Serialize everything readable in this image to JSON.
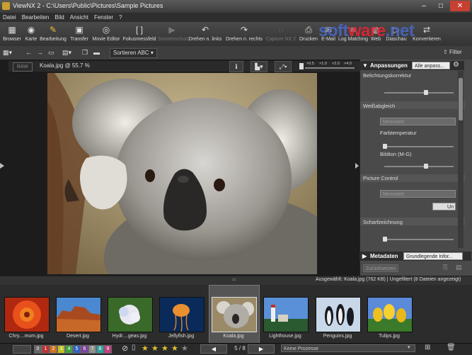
{
  "window": {
    "title": "ViewNX 2 - C:\\Users\\Public\\Pictures\\Sample Pictures",
    "minimize": "–",
    "maximize": "□",
    "close": "✕"
  },
  "menu": [
    "Datei",
    "Bearbeiten",
    "Bild",
    "Ansicht",
    "Fenster",
    "?"
  ],
  "toolbar": {
    "browser": "Browser",
    "karte": "Karte",
    "bearbeitung": "Bearbeitung",
    "transfer": "Transfer",
    "movie_editor": "Movie Editor",
    "fokus": "Fokusmessfeld",
    "sonnenschutz": "Sonnenschutz",
    "drehen_links": "Drehen n. links",
    "drehen_rechts": "Drehen n. rechts",
    "capture": "Capture NX 2",
    "drucken": "Drucken",
    "email": "E-Mail",
    "log_matching": "Log Matching",
    "web": "Web",
    "diashow": "Diaschau",
    "konvertieren": "Konvertieren"
  },
  "watermark": {
    "text_a": "soft",
    "text_b": "ware",
    "text_c": ".net"
  },
  "toolbar2": {
    "sort_label": "Sortieren",
    "sort_value": "ABC",
    "filter": "Filter"
  },
  "viewer": {
    "raw_tag": "RAW",
    "file_label": "Koala.jpg @ 55.7 %",
    "zoom_levels": [
      "×0.5",
      "×1.0",
      "×2.0",
      "×4.0"
    ]
  },
  "panel": {
    "header": "Anpassungen",
    "preset": "Alle anpass...",
    "exposure": "Belichtungskorrektur",
    "whitebalance": "Weißabgleich",
    "measured": "Messwert",
    "colortemp": "Farbtemperatur",
    "tint": "Bildton (M-G)",
    "picture_control": "Picture Control",
    "measured2": "Messwert",
    "btn_un": "Un",
    "sharpening": "Scharfzeichnung",
    "metadata_header": "Metadaten",
    "metadata_value": "Grundlegende Infor...",
    "reset": "Zurücksetzen"
  },
  "status": {
    "selected": "Ausgewählt: Koala.jpg (762 KB) | Ungefiltert (8 Dateien angezeigt)"
  },
  "thumbnails": [
    {
      "name": "Chry....mum.jpg"
    },
    {
      "name": "Desert.jpg"
    },
    {
      "name": "Hydr....geas.jpg"
    },
    {
      "name": "Jellyfish.jpg"
    },
    {
      "name": "Koala.jpg"
    },
    {
      "name": "Lighthouse.jpg"
    },
    {
      "name": "Penguins.jpg"
    },
    {
      "name": "Tulips.jpg"
    }
  ],
  "bottom": {
    "labels": [
      "0",
      "1",
      "2",
      "3",
      "4",
      "5",
      "6",
      "7",
      "8",
      "9"
    ],
    "page": "5 / 8",
    "process": "Keine Prozesse"
  },
  "colors": {
    "label_colors": [
      "#666",
      "#c03030",
      "#d07020",
      "#c0c020",
      "#40a040",
      "#3060c0",
      "#8040a0",
      "#909090",
      "#30a0a0",
      "#c04080"
    ]
  }
}
